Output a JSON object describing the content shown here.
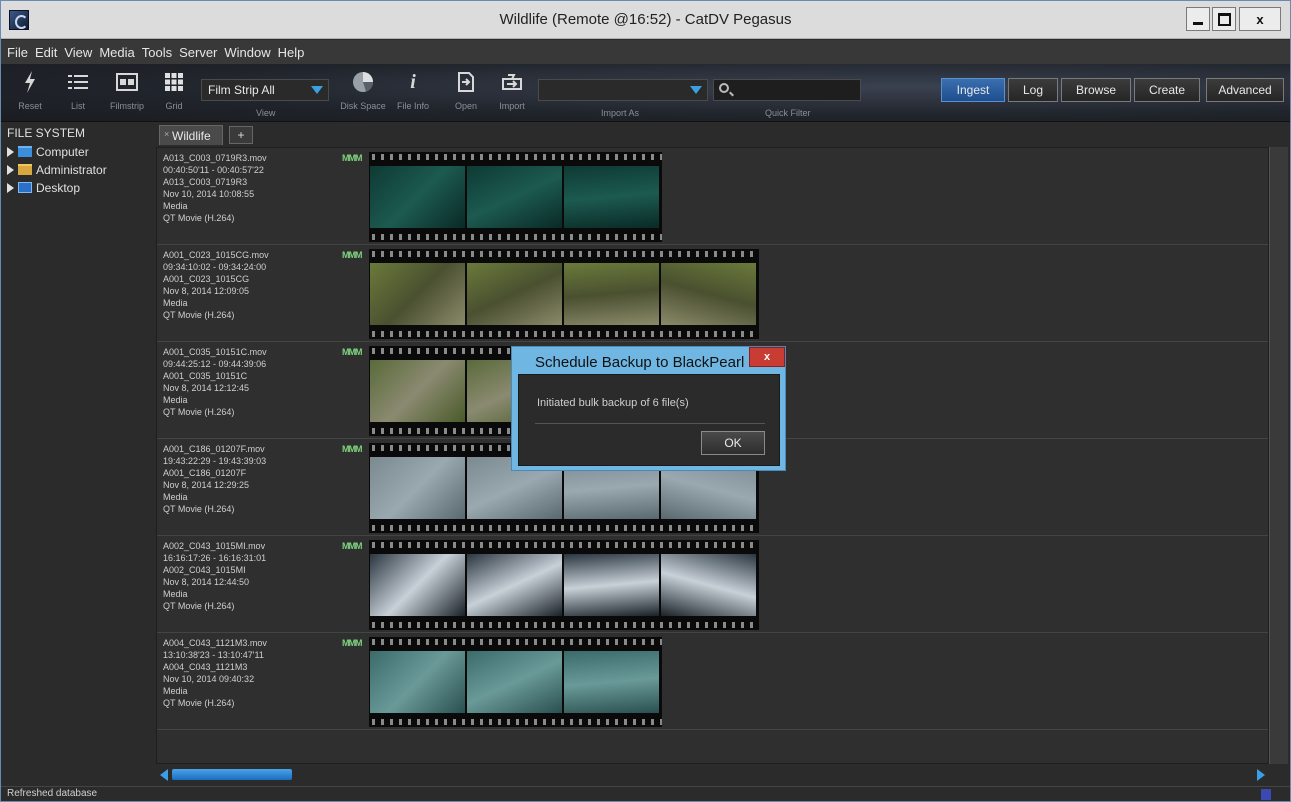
{
  "window": {
    "title": "Wildlife (Remote @16:52) - CatDV Pegasus"
  },
  "menu": [
    "File",
    "Edit",
    "View",
    "Media",
    "Tools",
    "Server",
    "Window",
    "Help"
  ],
  "toolbar": {
    "reset_label": "Reset",
    "list_label": "List",
    "filmstrip_label": "Filmstrip",
    "grid_label": "Grid",
    "view_label": "View",
    "view_value": "Film Strip All",
    "disk_space_label": "Disk Space",
    "file_info_label": "File Info",
    "open_label": "Open",
    "import_label": "Import",
    "import_as_label": "Import As",
    "import_as_value": "",
    "quick_filter_label": "Quick Filter",
    "quick_filter_value": "",
    "modes": [
      "Ingest",
      "Log",
      "Browse",
      "Create",
      "Advanced"
    ],
    "active_mode": "Ingest"
  },
  "sidebar": {
    "title": "FILE SYSTEM",
    "items": [
      {
        "label": "Computer",
        "icon": "folder-icon"
      },
      {
        "label": "Administrator",
        "icon": "user-folder-icon"
      },
      {
        "label": "Desktop",
        "icon": "desktop-icon"
      }
    ]
  },
  "tabs": {
    "active": "Wildlife",
    "add_label": "+"
  },
  "clips": [
    {
      "filename": "A013_C003_0719R3.mov",
      "timecode": "00:40:50'11 - 00:40:57'22",
      "name": "A013_C003_0719R3",
      "date": "Nov 10, 2014 10:08:55",
      "media": "Media",
      "format": "QT Movie (H.264)",
      "badge": "MMM",
      "frames": 3
    },
    {
      "filename": "A001_C023_1015CG.mov",
      "timecode": "09:34:10:02 - 09:34:24:00",
      "name": "A001_C023_1015CG",
      "date": "Nov 8, 2014 12:09:05",
      "media": "Media",
      "format": "QT Movie (H.264)",
      "badge": "MMM",
      "frames": 4
    },
    {
      "filename": "A001_C035_10151C.mov",
      "timecode": "09:44:25:12 - 09:44:39:06",
      "name": "A001_C035_10151C",
      "date": "Nov 8, 2014 12:12:45",
      "media": "Media",
      "format": "QT Movie (H.264)",
      "badge": "MMM",
      "frames": 4
    },
    {
      "filename": "A001_C186_01207F.mov",
      "timecode": "19:43:22:29 - 19:43:39:03",
      "name": "A001_C186_01207F",
      "date": "Nov 8, 2014 12:29:25",
      "media": "Media",
      "format": "QT Movie (H.264)",
      "badge": "MMM",
      "frames": 4
    },
    {
      "filename": "A002_C043_1015MI.mov",
      "timecode": "16:16:17:26 - 16:16:31:01",
      "name": "A002_C043_1015MI",
      "date": "Nov 8, 2014 12:44:50",
      "media": "Media",
      "format": "QT Movie (H.264)",
      "badge": "MMM",
      "frames": 4
    },
    {
      "filename": "A004_C043_1121M3.mov",
      "timecode": "13:10:38'23 - 13:10:47'11",
      "name": "A004_C043_1121M3",
      "date": "Nov 10, 2014 09:40:32",
      "media": "Media",
      "format": "QT Movie (H.264)",
      "badge": "MMM",
      "frames": 3
    }
  ],
  "status": {
    "text": "Refreshed database"
  },
  "dialog": {
    "title": "Schedule Backup to BlackPearl",
    "close_label": "x",
    "message": "Initiated bulk backup of 6 file(s)",
    "ok_label": "OK"
  },
  "colors": {
    "accent": "#3a9ee8",
    "dialog_frame": "#6fb7e2",
    "close_red": "#c83c34",
    "badge_green": "#7ed07e"
  }
}
